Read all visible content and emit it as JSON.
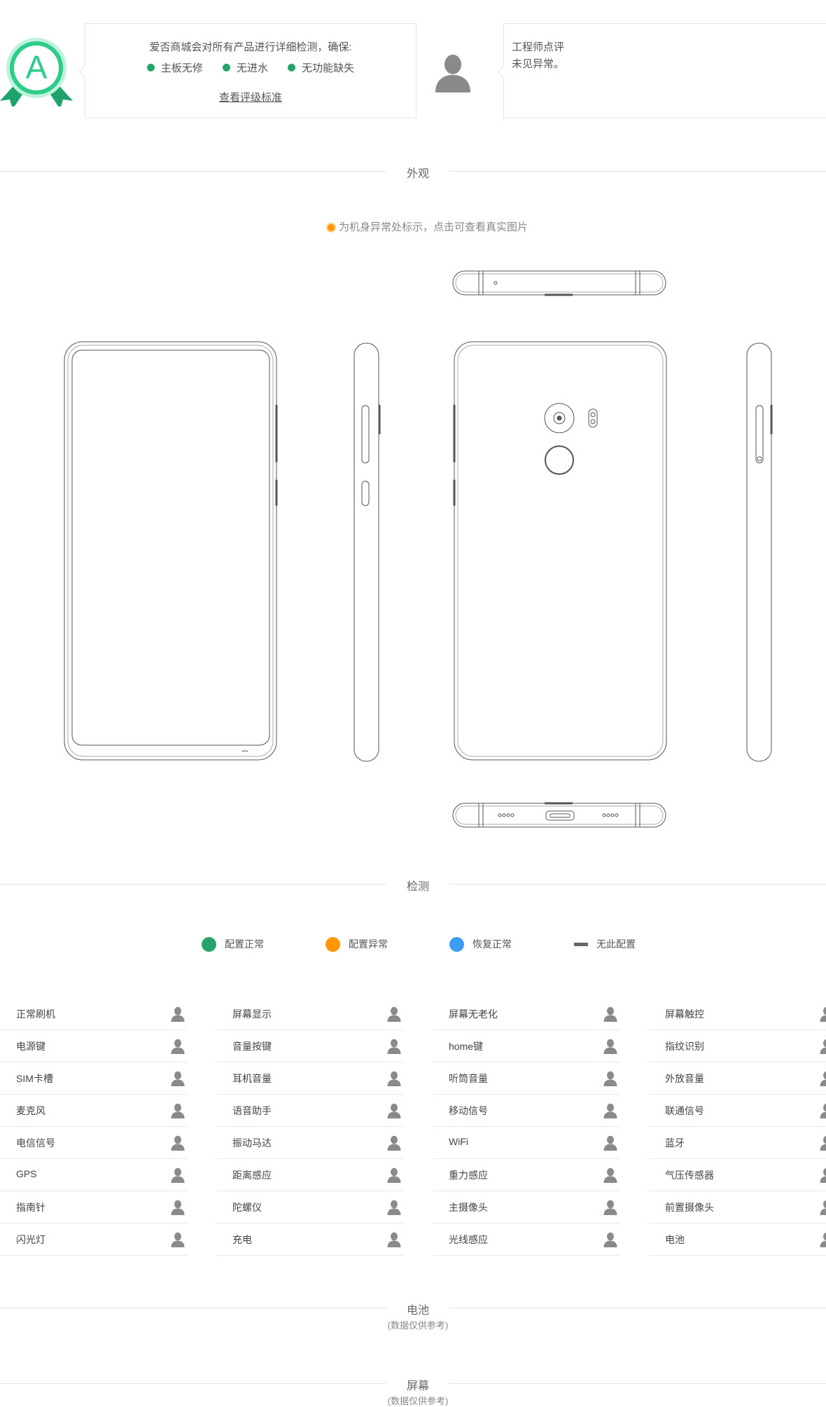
{
  "grade": {
    "letter": "A",
    "badge_color": "#2ecc8a",
    "description": "爱否商城会对所有产品进行详细检测，确保:",
    "checks": [
      "主板无修",
      "无进水",
      "无功能缺失"
    ],
    "check_color": "#27a46c",
    "link_label": "查看评级标准"
  },
  "engineer": {
    "title": "工程师点评",
    "comment": "未见异常。"
  },
  "sections": {
    "appearance": "外观",
    "detection": "检测",
    "battery": "电池",
    "battery_note": "(数据仅供参考)",
    "screen": "屏幕",
    "screen_note": "(数据仅供参考)"
  },
  "appearance": {
    "hint": "为机身异常处标示，点击可查看真实图片",
    "marker_color": "#ff9800"
  },
  "legend": [
    {
      "label": "配置正常",
      "color": "#27a46c",
      "shape": "dot"
    },
    {
      "label": "配置异常",
      "color": "#ff9800",
      "shape": "dot"
    },
    {
      "label": "恢复正常",
      "color": "#3d9bf3",
      "shape": "dot"
    },
    {
      "label": "无此配置",
      "color": "#666666",
      "shape": "dash"
    }
  ],
  "checks": [
    [
      "正常刷机",
      "电源键",
      "SIM卡槽",
      "麦克风",
      "电信信号",
      "GPS",
      "指南针",
      "闪光灯"
    ],
    [
      "屏幕显示",
      "音量按键",
      "耳机音量",
      "语音助手",
      "振动马达",
      "距离感应",
      "陀螺仪",
      "充电"
    ],
    [
      "屏幕无老化",
      "home键",
      "听筒音量",
      "移动信号",
      "WiFi",
      "重力感应",
      "主摄像头",
      "光线感应"
    ],
    [
      "屏幕触控",
      "指纹识别",
      "外放音量",
      "联通信号",
      "蓝牙",
      "气压传感器",
      "前置摄像头",
      "电池"
    ]
  ],
  "check_icon": "person-icon"
}
